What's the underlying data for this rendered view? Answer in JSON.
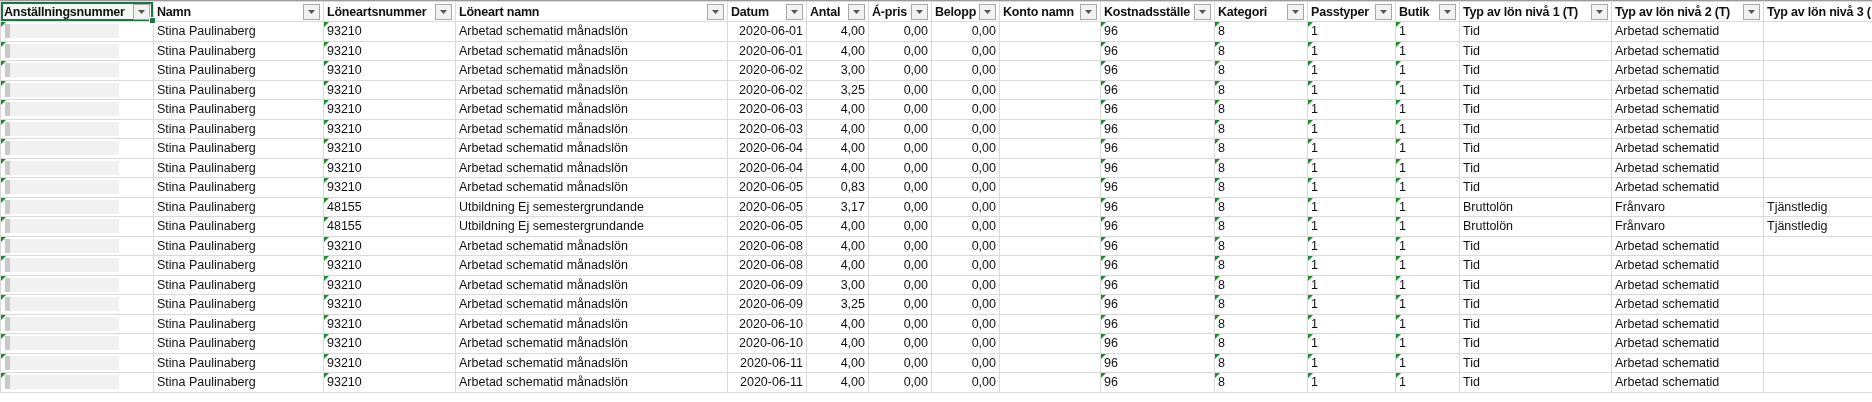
{
  "columns": [
    {
      "label": "Anställningsnummer",
      "kind": "redacted",
      "selected": true
    },
    {
      "label": "Namn",
      "kind": "text",
      "selected": false
    },
    {
      "label": "Löneartsnummer",
      "kind": "flagged",
      "selected": false
    },
    {
      "label": "Löneart namn",
      "kind": "text",
      "selected": false
    },
    {
      "label": "Datum",
      "kind": "number",
      "selected": false
    },
    {
      "label": "Antal",
      "kind": "number",
      "selected": false
    },
    {
      "label": "Á-pris",
      "kind": "number",
      "selected": false
    },
    {
      "label": "Belopp",
      "kind": "number",
      "selected": false
    },
    {
      "label": "Konto namn",
      "kind": "text",
      "selected": false
    },
    {
      "label": "Kostnadsställe",
      "kind": "flagged",
      "selected": false
    },
    {
      "label": "Kategori",
      "kind": "flagged",
      "selected": false
    },
    {
      "label": "Passtyper",
      "kind": "flagged",
      "selected": false
    },
    {
      "label": "Butik",
      "kind": "flagged",
      "selected": false
    },
    {
      "label": "Typ av lön nivå 1 (T)",
      "kind": "text",
      "selected": false
    },
    {
      "label": "Typ av lön nivå 2 (T)",
      "kind": "text",
      "selected": false
    },
    {
      "label": "Typ av lön nivå 3 (",
      "kind": "text",
      "selected": false
    }
  ],
  "rows": [
    [
      null,
      "Stina Paulinaberg",
      "93210",
      "Arbetad schematid månadslön",
      "2020-06-01",
      "4,00",
      "0,00",
      "0,00",
      null,
      "96",
      "8",
      "1",
      "1",
      "Tid",
      "Arbetad schematid",
      null
    ],
    [
      null,
      "Stina Paulinaberg",
      "93210",
      "Arbetad schematid månadslön",
      "2020-06-01",
      "4,00",
      "0,00",
      "0,00",
      null,
      "96",
      "8",
      "1",
      "1",
      "Tid",
      "Arbetad schematid",
      null
    ],
    [
      null,
      "Stina Paulinaberg",
      "93210",
      "Arbetad schematid månadslön",
      "2020-06-02",
      "3,00",
      "0,00",
      "0,00",
      null,
      "96",
      "8",
      "1",
      "1",
      "Tid",
      "Arbetad schematid",
      null
    ],
    [
      null,
      "Stina Paulinaberg",
      "93210",
      "Arbetad schematid månadslön",
      "2020-06-02",
      "3,25",
      "0,00",
      "0,00",
      null,
      "96",
      "8",
      "1",
      "1",
      "Tid",
      "Arbetad schematid",
      null
    ],
    [
      null,
      "Stina Paulinaberg",
      "93210",
      "Arbetad schematid månadslön",
      "2020-06-03",
      "4,00",
      "0,00",
      "0,00",
      null,
      "96",
      "8",
      "1",
      "1",
      "Tid",
      "Arbetad schematid",
      null
    ],
    [
      null,
      "Stina Paulinaberg",
      "93210",
      "Arbetad schematid månadslön",
      "2020-06-03",
      "4,00",
      "0,00",
      "0,00",
      null,
      "96",
      "8",
      "1",
      "1",
      "Tid",
      "Arbetad schematid",
      null
    ],
    [
      null,
      "Stina Paulinaberg",
      "93210",
      "Arbetad schematid månadslön",
      "2020-06-04",
      "4,00",
      "0,00",
      "0,00",
      null,
      "96",
      "8",
      "1",
      "1",
      "Tid",
      "Arbetad schematid",
      null
    ],
    [
      null,
      "Stina Paulinaberg",
      "93210",
      "Arbetad schematid månadslön",
      "2020-06-04",
      "4,00",
      "0,00",
      "0,00",
      null,
      "96",
      "8",
      "1",
      "1",
      "Tid",
      "Arbetad schematid",
      null
    ],
    [
      null,
      "Stina Paulinaberg",
      "93210",
      "Arbetad schematid månadslön",
      "2020-06-05",
      "0,83",
      "0,00",
      "0,00",
      null,
      "96",
      "8",
      "1",
      "1",
      "Tid",
      "Arbetad schematid",
      null
    ],
    [
      null,
      "Stina Paulinaberg",
      "48155",
      "Utbildning Ej semestergrundande",
      "2020-06-05",
      "3,17",
      "0,00",
      "0,00",
      null,
      "96",
      "8",
      "1",
      "1",
      "Bruttolön",
      "Frånvaro",
      "Tjänstledig"
    ],
    [
      null,
      "Stina Paulinaberg",
      "48155",
      "Utbildning Ej semestergrundande",
      "2020-06-05",
      "4,00",
      "0,00",
      "0,00",
      null,
      "96",
      "8",
      "1",
      "1",
      "Bruttolön",
      "Frånvaro",
      "Tjänstledig"
    ],
    [
      null,
      "Stina Paulinaberg",
      "93210",
      "Arbetad schematid månadslön",
      "2020-06-08",
      "4,00",
      "0,00",
      "0,00",
      null,
      "96",
      "8",
      "1",
      "1",
      "Tid",
      "Arbetad schematid",
      null
    ],
    [
      null,
      "Stina Paulinaberg",
      "93210",
      "Arbetad schematid månadslön",
      "2020-06-08",
      "4,00",
      "0,00",
      "0,00",
      null,
      "96",
      "8",
      "1",
      "1",
      "Tid",
      "Arbetad schematid",
      null
    ],
    [
      null,
      "Stina Paulinaberg",
      "93210",
      "Arbetad schematid månadslön",
      "2020-06-09",
      "3,00",
      "0,00",
      "0,00",
      null,
      "96",
      "8",
      "1",
      "1",
      "Tid",
      "Arbetad schematid",
      null
    ],
    [
      null,
      "Stina Paulinaberg",
      "93210",
      "Arbetad schematid månadslön",
      "2020-06-09",
      "3,25",
      "0,00",
      "0,00",
      null,
      "96",
      "8",
      "1",
      "1",
      "Tid",
      "Arbetad schematid",
      null
    ],
    [
      null,
      "Stina Paulinaberg",
      "93210",
      "Arbetad schematid månadslön",
      "2020-06-10",
      "4,00",
      "0,00",
      "0,00",
      null,
      "96",
      "8",
      "1",
      "1",
      "Tid",
      "Arbetad schematid",
      null
    ],
    [
      null,
      "Stina Paulinaberg",
      "93210",
      "Arbetad schematid månadslön",
      "2020-06-10",
      "4,00",
      "0,00",
      "0,00",
      null,
      "96",
      "8",
      "1",
      "1",
      "Tid",
      "Arbetad schematid",
      null
    ],
    [
      null,
      "Stina Paulinaberg",
      "93210",
      "Arbetad schematid månadslön",
      "2020-06-11",
      "4,00",
      "0,00",
      "0,00",
      null,
      "96",
      "8",
      "1",
      "1",
      "Tid",
      "Arbetad schematid",
      null
    ],
    [
      null,
      "Stina Paulinaberg",
      "93210",
      "Arbetad schematid månadslön",
      "2020-06-11",
      "4,00",
      "0,00",
      "0,00",
      null,
      "96",
      "8",
      "1",
      "1",
      "Tid",
      "Arbetad schematid",
      null
    ]
  ]
}
